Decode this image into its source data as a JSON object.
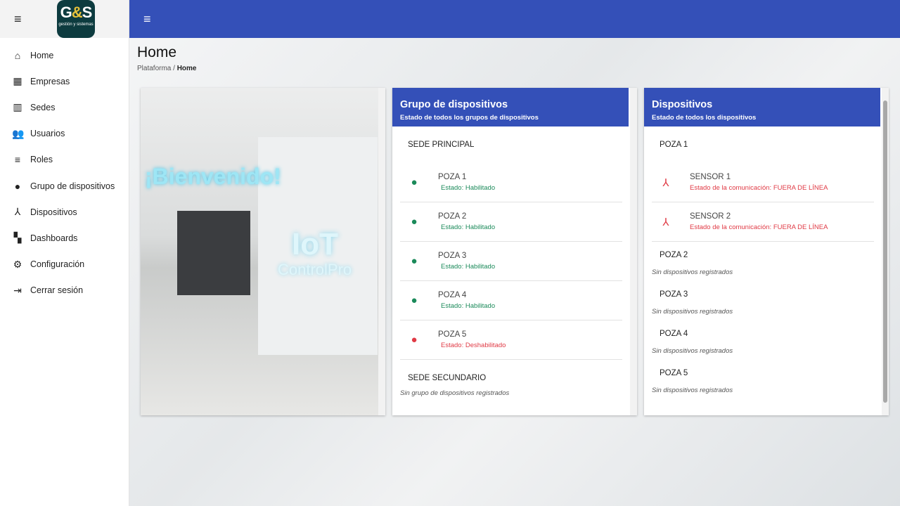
{
  "brand": {
    "logo_text": "G&S",
    "logo_sub": "gestión y sistemas"
  },
  "sidebar": {
    "items": [
      {
        "label": "Home",
        "icon": "home-icon",
        "glyph": "⌂"
      },
      {
        "label": "Empresas",
        "icon": "building-icon",
        "glyph": "▦"
      },
      {
        "label": "Sedes",
        "icon": "city-icon",
        "glyph": "▥"
      },
      {
        "label": "Usuarios",
        "icon": "users-icon",
        "glyph": "👥"
      },
      {
        "label": "Roles",
        "icon": "roles-icon",
        "glyph": "≡"
      },
      {
        "label": "Grupo de dispositivos",
        "icon": "device-group-icon",
        "glyph": "●"
      },
      {
        "label": "Dispositivos",
        "icon": "device-hub-icon",
        "glyph": "⅄"
      },
      {
        "label": "Dashboards",
        "icon": "dashboard-icon",
        "glyph": "▚"
      },
      {
        "label": "Configuración",
        "icon": "gear-icon",
        "glyph": "⚙"
      },
      {
        "label": "Cerrar sesión",
        "icon": "logout-icon",
        "glyph": "⇥"
      }
    ]
  },
  "page": {
    "title": "Home",
    "breadcrumb": [
      "Plataforma",
      "/",
      "Home"
    ]
  },
  "welcome": {
    "title": "¡Bienvenido!",
    "iot": "IoT",
    "brand": "ControlPro"
  },
  "groups": {
    "title": "Grupo de dispositivos",
    "subtitle": "Estado de todos los grupos de dispositivos",
    "sede1": "SEDE PRINCIPAL",
    "items": [
      {
        "name": "POZA 1",
        "status": "Estado: Habilitado"
      },
      {
        "name": "POZA 2",
        "status": "Estado: Habilitado"
      },
      {
        "name": "POZA 3",
        "status": "Estado: Habilitado"
      },
      {
        "name": "POZA 4",
        "status": "Estado: Habilitado"
      },
      {
        "name": "POZA 5",
        "status": "Estado: Deshabilitado"
      }
    ],
    "sede2": "SEDE SECUNDARIO",
    "sede2_empty": "Sin grupo de dispositivos registrados"
  },
  "devices": {
    "title": "Dispositivos",
    "subtitle": "Estado de todos los dispositivos",
    "poza1": "POZA 1",
    "sensors": [
      {
        "name": "SENSOR 1",
        "status": "Estado de la comunicación: FUERA DE LÍNEA"
      },
      {
        "name": "SENSOR 2",
        "status": "Estado de la comunicación: FUERA DE LÍNEA"
      }
    ],
    "others": [
      {
        "name": "POZA 2",
        "empty": "Sin dispositivos registrados"
      },
      {
        "name": "POZA 3",
        "empty": "Sin dispositivos registrados"
      },
      {
        "name": "POZA 4",
        "empty": "Sin dispositivos registrados"
      },
      {
        "name": "POZA 5",
        "empty": "Sin dispositivos registrados"
      }
    ]
  },
  "colors": {
    "primary": "#3450b8",
    "ok": "#1b8a5a",
    "error": "#e03a45"
  }
}
